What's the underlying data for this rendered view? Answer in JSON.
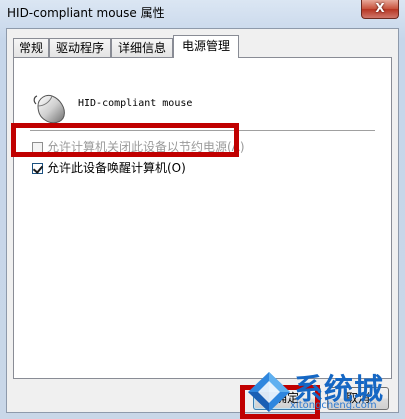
{
  "window": {
    "title": "HID-compliant mouse 属性",
    "close_label": "X"
  },
  "tabs": [
    {
      "label": "常规",
      "active": false
    },
    {
      "label": "驱动程序",
      "active": false
    },
    {
      "label": "详细信息",
      "active": false
    },
    {
      "label": "电源管理",
      "active": true
    }
  ],
  "device": {
    "name": "HID-compliant mouse",
    "icon": "mouse-icon"
  },
  "options": {
    "allow_turn_off": {
      "label": "允许计算机关闭此设备以节约电源(A)",
      "checked": false,
      "enabled": false
    },
    "allow_wake": {
      "label": "允许此设备唤醒计算机(O)",
      "checked": true,
      "enabled": true
    }
  },
  "buttons": {
    "ok": "确定",
    "cancel": "取消"
  },
  "watermark": {
    "text": "系统城",
    "url": "xitongcheng.com"
  },
  "colors": {
    "highlight": "#c00000",
    "watermark": "#1567c4"
  }
}
